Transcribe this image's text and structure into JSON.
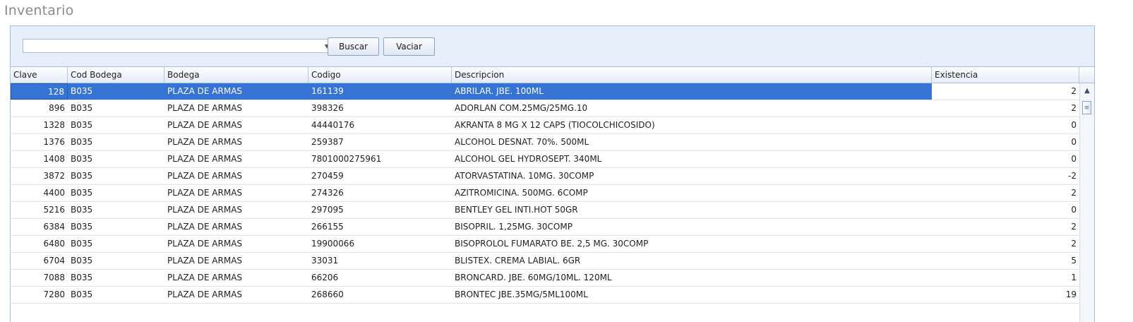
{
  "page": {
    "title": "Inventario"
  },
  "toolbar": {
    "search_value": "",
    "search_placeholder": "",
    "buscar_label": "Buscar",
    "vaciar_label": "Vaciar"
  },
  "grid": {
    "columns": [
      "Clave",
      "Cod Bodega",
      "Bodega",
      "Codigo",
      "Descripcion",
      "Existencia"
    ],
    "selected_row": 0,
    "rows": [
      {
        "clave": "128",
        "cod_bodega": "B035",
        "bodega": "PLAZA DE ARMAS",
        "codigo": "161139",
        "descripcion": "ABRILAR. JBE. 100ML",
        "existencia": "2"
      },
      {
        "clave": "896",
        "cod_bodega": "B035",
        "bodega": "PLAZA DE ARMAS",
        "codigo": "398326",
        "descripcion": "ADORLAN COM.25MG/25MG.10",
        "existencia": "2"
      },
      {
        "clave": "1328",
        "cod_bodega": "B035",
        "bodega": "PLAZA DE ARMAS",
        "codigo": "44440176",
        "descripcion": "AKRANTA 8 MG X 12 CAPS (TIOCOLCHICOSIDO)",
        "existencia": "0"
      },
      {
        "clave": "1376",
        "cod_bodega": "B035",
        "bodega": "PLAZA DE ARMAS",
        "codigo": "259387",
        "descripcion": "ALCOHOL DESNAT. 70%. 500ML",
        "existencia": "0"
      },
      {
        "clave": "1408",
        "cod_bodega": "B035",
        "bodega": "PLAZA DE ARMAS",
        "codigo": "7801000275961",
        "descripcion": "ALCOHOL GEL HYDROSEPT. 340ML",
        "existencia": "0"
      },
      {
        "clave": "3872",
        "cod_bodega": "B035",
        "bodega": "PLAZA DE ARMAS",
        "codigo": "270459",
        "descripcion": "ATORVASTATINA. 10MG. 30COMP",
        "existencia": "-2"
      },
      {
        "clave": "4400",
        "cod_bodega": "B035",
        "bodega": "PLAZA DE ARMAS",
        "codigo": "274326",
        "descripcion": "AZITROMICINA. 500MG. 6COMP",
        "existencia": "2"
      },
      {
        "clave": "5216",
        "cod_bodega": "B035",
        "bodega": "PLAZA DE ARMAS",
        "codigo": "297095",
        "descripcion": "BENTLEY GEL INTI.HOT 50GR",
        "existencia": "0"
      },
      {
        "clave": "6384",
        "cod_bodega": "B035",
        "bodega": "PLAZA DE ARMAS",
        "codigo": "266155",
        "descripcion": "BISOPRIL. 1,25MG. 30COMP",
        "existencia": "2"
      },
      {
        "clave": "6480",
        "cod_bodega": "B035",
        "bodega": "PLAZA DE ARMAS",
        "codigo": "19900066",
        "descripcion": "BISOPROLOL FUMARATO BE. 2,5 MG. 30COMP",
        "existencia": "2"
      },
      {
        "clave": "6704",
        "cod_bodega": "B035",
        "bodega": "PLAZA DE ARMAS",
        "codigo": "33031",
        "descripcion": "BLISTEX. CREMA LABIAL. 6GR",
        "existencia": "5"
      },
      {
        "clave": "7088",
        "cod_bodega": "B035",
        "bodega": "PLAZA DE ARMAS",
        "codigo": "66206",
        "descripcion": "BRONCARD. JBE. 60MG/10ML. 120ML",
        "existencia": "1"
      },
      {
        "clave": "7280",
        "cod_bodega": "B035",
        "bodega": "PLAZA DE ARMAS",
        "codigo": "268660",
        "descripcion": "BRONTEC JBE.35MG/5ML100ML",
        "existencia": "19"
      }
    ]
  },
  "icons": {
    "combo_dropdown": "chevron-down-icon",
    "scroll_up": "scroll-up-arrow-icon",
    "scroll_thumb": "scroll-thumb-grip-icon"
  }
}
